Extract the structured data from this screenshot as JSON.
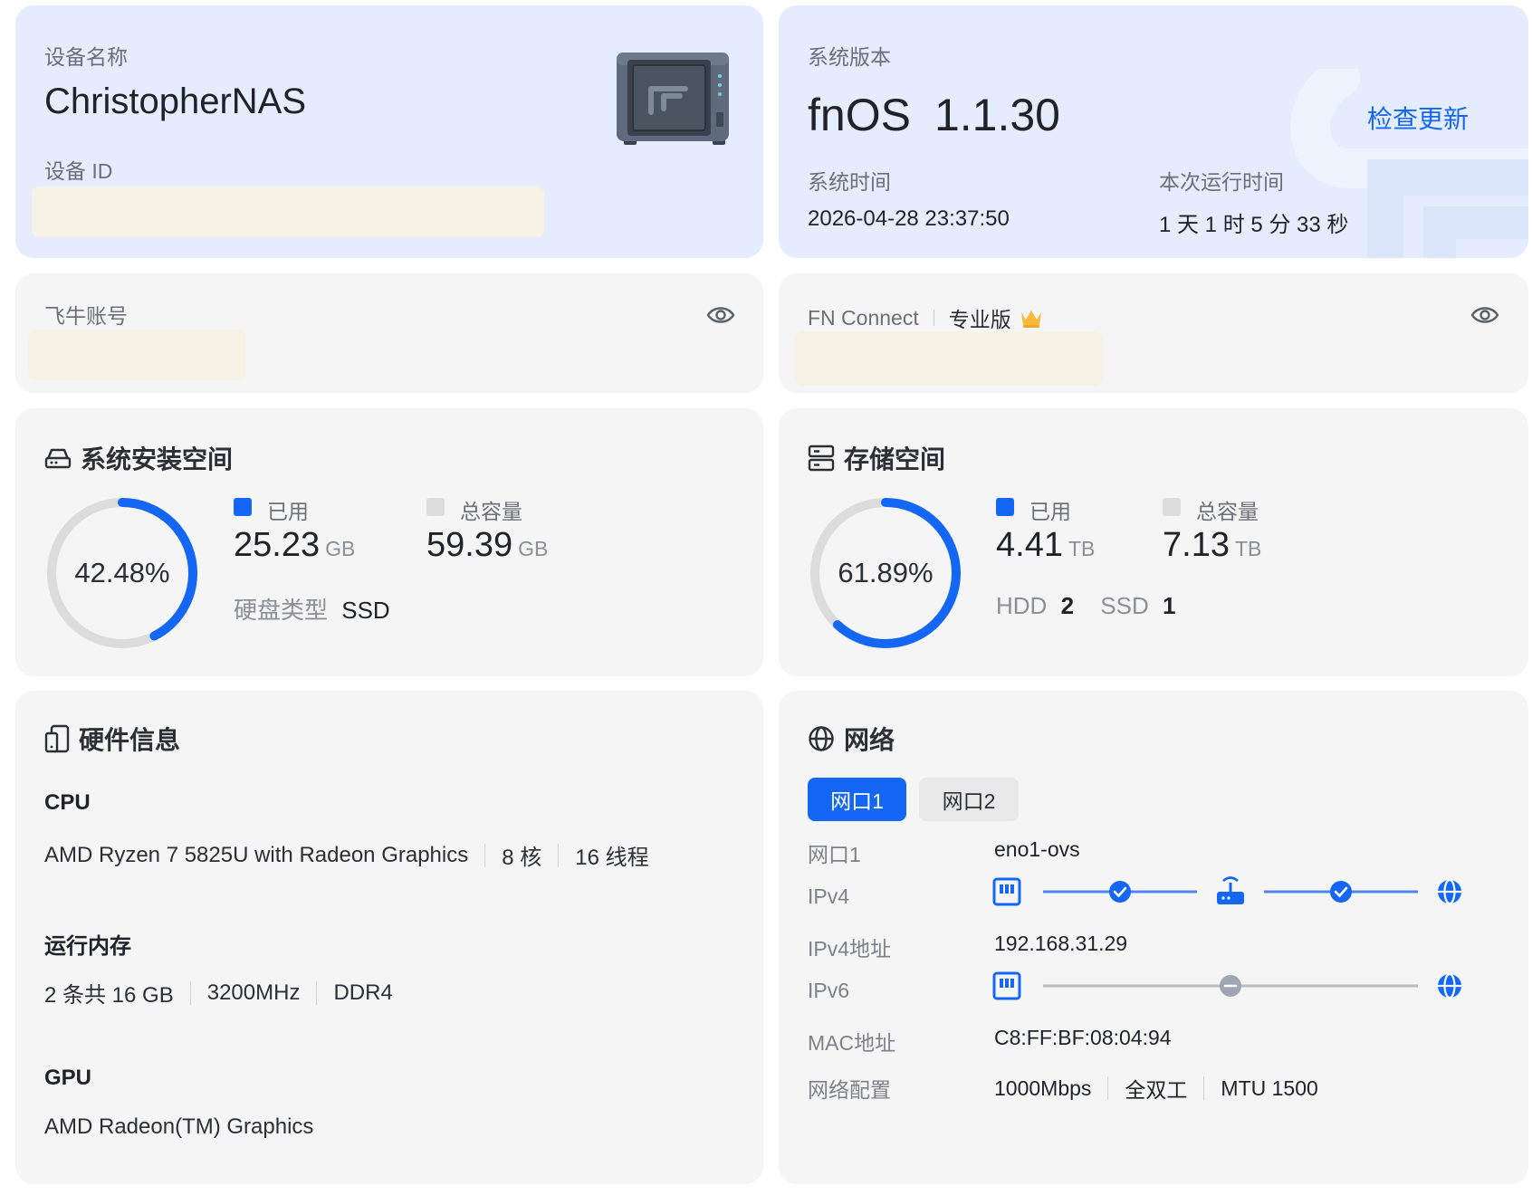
{
  "device": {
    "name_label": "设备名称",
    "name": "ChristopherNAS",
    "id_label": "设备 ID"
  },
  "system": {
    "version_label": "系统版本",
    "os_name": "fnOS",
    "version": "1.1.30",
    "check_update": "检查更新",
    "time_label": "系统时间",
    "time": "2026-04-28 23:37:50",
    "uptime_label": "本次运行时间",
    "uptime": "1 天 1 时 5 分 33 秒"
  },
  "account": {
    "label": "飞牛账号"
  },
  "fn_connect": {
    "label": "FN Connect",
    "edition": "专业版"
  },
  "system_space": {
    "title": "系统安装空间",
    "percent": "42.48%",
    "percent_value": 42.48,
    "used_label": "已用",
    "used": "25.23",
    "used_unit": "GB",
    "total_label": "总容量",
    "total": "59.39",
    "total_unit": "GB",
    "disk_type_label": "硬盘类型",
    "disk_type": "SSD"
  },
  "storage": {
    "title": "存储空间",
    "percent": "61.89%",
    "percent_value": 61.89,
    "used_label": "已用",
    "used": "4.41",
    "used_unit": "TB",
    "total_label": "总容量",
    "total": "7.13",
    "total_unit": "TB",
    "hdd_label": "HDD",
    "hdd_count": "2",
    "ssd_label": "SSD",
    "ssd_count": "1"
  },
  "hardware": {
    "title": "硬件信息",
    "cpu_label": "CPU",
    "cpu_model": "AMD Ryzen 7 5825U with Radeon Graphics",
    "cpu_cores": "8 核",
    "cpu_threads": "16 线程",
    "ram_label": "运行内存",
    "ram_size": "2 条共 16 GB",
    "ram_speed": "3200MHz",
    "ram_type": "DDR4",
    "gpu_label": "GPU",
    "gpu_model": "AMD Radeon(TM) Graphics"
  },
  "network": {
    "title": "网络",
    "tabs": [
      "网口1",
      "网口2"
    ],
    "port_label": "网口1",
    "port_value": "eno1-ovs",
    "ipv4_label": "IPv4",
    "ipv4_addr_label": "IPv4地址",
    "ipv4_addr": "192.168.31.29",
    "ipv6_label": "IPv6",
    "mac_label": "MAC地址",
    "mac": "C8:FF:BF:08:04:94",
    "config_label": "网络配置",
    "speed": "1000Mbps",
    "duplex": "全双工",
    "mtu": "MTU 1500"
  },
  "colors": {
    "accent": "#1467f5",
    "ring_track": "#dcdcdc",
    "card_blue": "#e4ecfd",
    "card_gray": "#f5f5f5",
    "crown": "#f7b93a"
  },
  "icons": [
    "nas-device-icon",
    "eye-icon",
    "crown-icon",
    "hard-drive-icon",
    "server-icon",
    "device-icon",
    "globe-icon",
    "check-icon",
    "router-icon",
    "nas-port-icon"
  ]
}
